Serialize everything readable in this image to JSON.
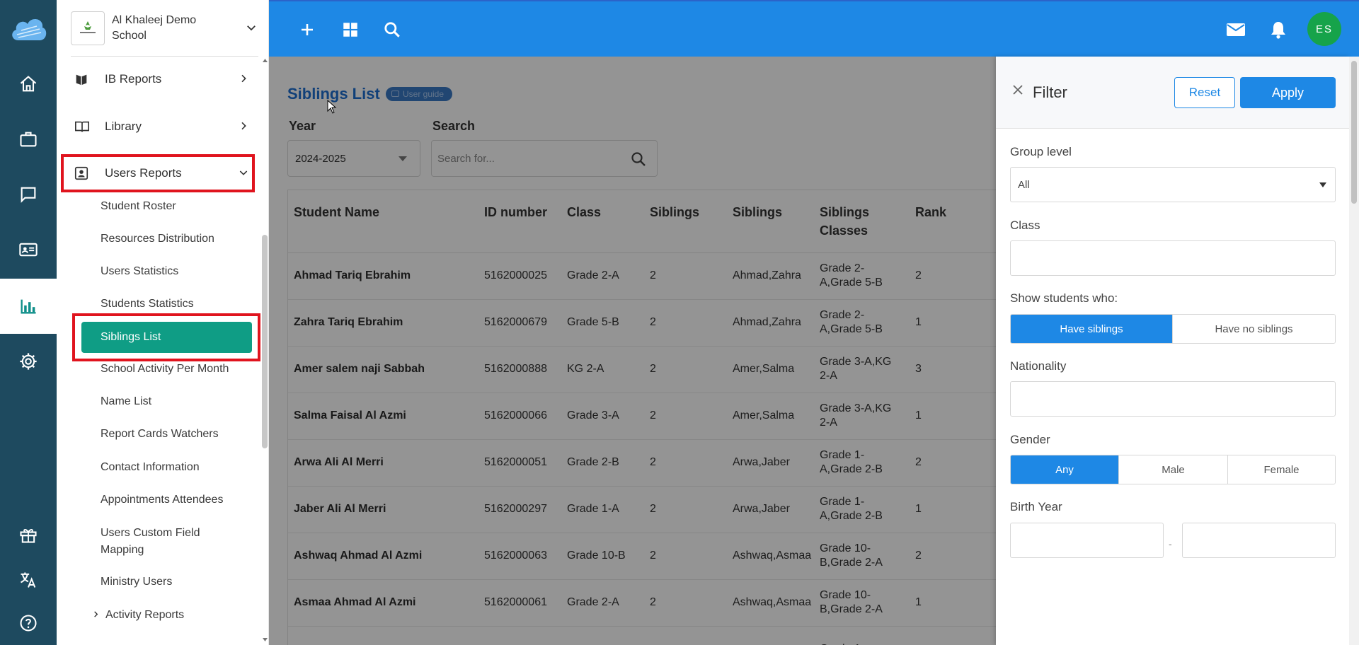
{
  "app": {
    "school_name": "Al Khaleej Demo School"
  },
  "rail": {
    "items": [
      "home-icon",
      "briefcase-icon",
      "chat-icon",
      "id-card-icon",
      "reports-chart-icon",
      "settings-gear-icon",
      "gift-icon",
      "translate-icon",
      "help-icon"
    ],
    "active": "reports-chart-icon"
  },
  "sidebar": {
    "ib_reports": "IB Reports",
    "library": "Library",
    "users_reports": "Users Reports",
    "subitems": [
      "Student Roster",
      "Resources Distribution",
      "Users Statistics",
      "Students Statistics",
      "Siblings List",
      "School Activity Per Month",
      "Name List",
      "Report Cards Watchers",
      "Contact Information",
      "Appointments Attendees",
      "Users Custom Field Mapping",
      "Ministry Users"
    ],
    "active_subitem": "Siblings List",
    "activity_reports": "Activity Reports"
  },
  "topbar": {
    "avatar_initials": "ES",
    "icons": [
      "plus-icon",
      "grid-icon",
      "search-icon",
      "mail-icon",
      "bell-icon"
    ]
  },
  "main": {
    "title": "Siblings List",
    "user_guide": "User guide",
    "year_label": "Year",
    "year_value": "2024-2025",
    "search_label": "Search",
    "search_placeholder": "Search for...",
    "columns": [
      "Student Name",
      "ID number",
      "Class",
      "Siblings",
      "Siblings",
      "Siblings Classes",
      "Rank"
    ],
    "rows": [
      [
        "Ahmad Tariq Ebrahim",
        "5162000025",
        "Grade 2-A",
        "2",
        "Ahmad,Zahra",
        "Grade 2-A,Grade 5-B",
        "2"
      ],
      [
        "Zahra Tariq Ebrahim",
        "5162000679",
        "Grade 5-B",
        "2",
        "Ahmad,Zahra",
        "Grade 2-A,Grade 5-B",
        "1"
      ],
      [
        "Amer salem naji Sabbah",
        "5162000888",
        "KG 2-A",
        "2",
        "Amer,Salma",
        "Grade 3-A,KG 2-A",
        "3"
      ],
      [
        "Salma Faisal Al Azmi",
        "5162000066",
        "Grade 3-A",
        "2",
        "Amer,Salma",
        "Grade 3-A,KG 2-A",
        "1"
      ],
      [
        "Arwa Ali Al Merri",
        "5162000051",
        "Grade 2-B",
        "2",
        "Arwa,Jaber",
        "Grade 1-A,Grade 2-B",
        "2"
      ],
      [
        "Jaber Ali Al Merri",
        "5162000297",
        "Grade 1-A",
        "2",
        "Arwa,Jaber",
        "Grade 1-A,Grade 2-B",
        "1"
      ],
      [
        "Ashwaq Ahmad Al Azmi",
        "5162000063",
        "Grade 10-B",
        "2",
        "Ashwaq,Asmaa",
        "Grade 10-B,Grade 2-A",
        "2"
      ],
      [
        "Asmaa Ahmad Al Azmi",
        "5162000061",
        "Grade 2-A",
        "2",
        "Ashwaq,Asmaa",
        "Grade 10-B,Grade 2-A",
        "1"
      ],
      [
        "",
        "",
        "",
        "",
        "",
        "Grade 1-",
        ""
      ]
    ]
  },
  "filter": {
    "title": "Filter",
    "reset": "Reset",
    "apply": "Apply",
    "group_level_label": "Group level",
    "group_level_value": "All",
    "class_label": "Class",
    "class_value": "",
    "show_label": "Show students who:",
    "show_options": [
      "Have siblings",
      "Have no siblings"
    ],
    "show_selected": "Have siblings",
    "nationality_label": "Nationality",
    "nationality_value": "",
    "gender_label": "Gender",
    "gender_options": [
      "Any",
      "Male",
      "Female"
    ],
    "gender_selected": "Any",
    "birth_year_label": "Birth Year",
    "birth_year_separator": "-",
    "birth_year_from": "",
    "birth_year_to": ""
  },
  "colors": {
    "topbar": "#1e88e5",
    "rail": "#1e4a5f",
    "active_subitem": "#0f9d85",
    "highlight_box": "#e0141e",
    "avatar": "#16a34a"
  }
}
